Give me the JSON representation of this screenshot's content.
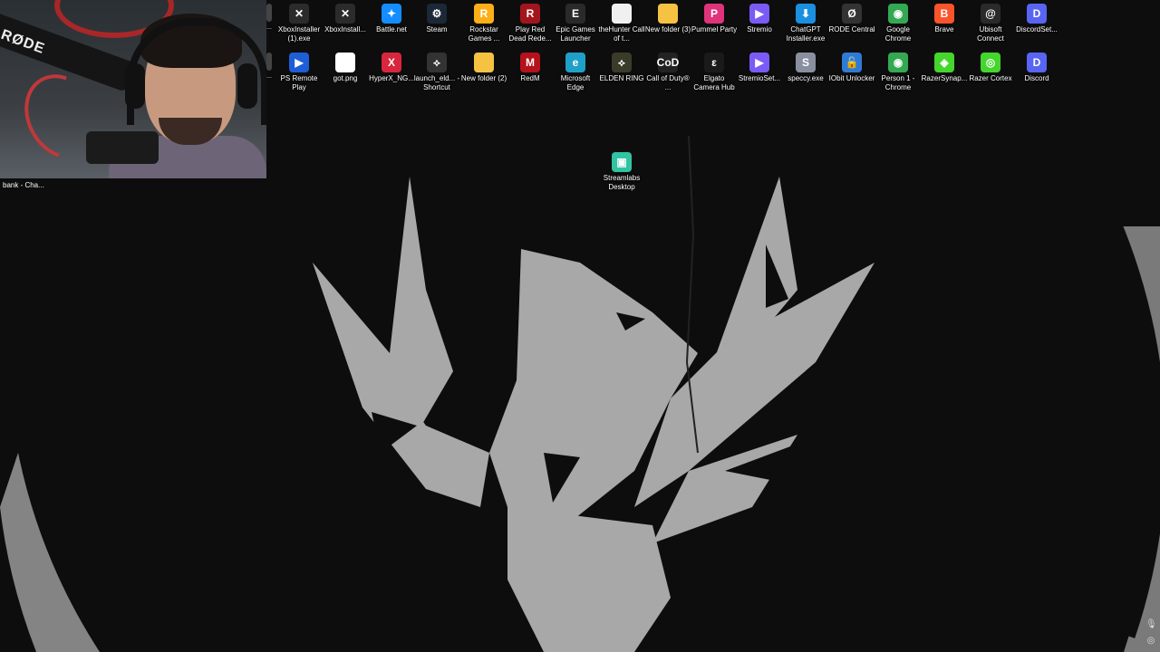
{
  "webcam": {
    "caption": "bank - Cha...",
    "mic_brand": "RØDE"
  },
  "desktop_icons": [
    {
      "label": "...",
      "icon": "generic-file-icon",
      "color": "#444444",
      "glyph": ""
    },
    {
      "label": "XboxInstaller (1).exe",
      "icon": "xbox-icon",
      "color": "#2b2b2b",
      "glyph": "✕"
    },
    {
      "label": "XboxInstall...",
      "icon": "xbox-icon",
      "color": "#2b2b2b",
      "glyph": "✕"
    },
    {
      "label": "Battle.net",
      "icon": "battlenet-icon",
      "color": "#148eff",
      "glyph": "✦"
    },
    {
      "label": "Steam",
      "icon": "steam-icon",
      "color": "#1b2838",
      "glyph": "⚙"
    },
    {
      "label": "Rockstar Games ...",
      "icon": "rockstar-icon",
      "color": "#fcaf17",
      "glyph": "R"
    },
    {
      "label": "Play Red Dead Rede...",
      "icon": "rdr2-icon",
      "color": "#a3151c",
      "glyph": "R"
    },
    {
      "label": "Epic Games Launcher",
      "icon": "epic-icon",
      "color": "#2a2a2a",
      "glyph": "E"
    },
    {
      "label": "theHunter Call of t...",
      "icon": "file-icon",
      "color": "#f0f0f0",
      "glyph": ""
    },
    {
      "label": "New folder (3)",
      "icon": "folder-icon",
      "color": "#f5c242",
      "glyph": ""
    },
    {
      "label": "Pummel Party",
      "icon": "pummel-party-icon",
      "color": "#e0337b",
      "glyph": "P"
    },
    {
      "label": "Stremio",
      "icon": "stremio-icon",
      "color": "#7b5bf5",
      "glyph": "▶"
    },
    {
      "label": "ChatGPT Installer.exe",
      "icon": "download-icon",
      "color": "#1b8fe0",
      "glyph": "⬇"
    },
    {
      "label": "RODE Central",
      "icon": "rode-icon",
      "color": "#333333",
      "glyph": "Ø"
    },
    {
      "label": "Google Chrome",
      "icon": "chrome-icon",
      "color": "#34a853",
      "glyph": "◉"
    },
    {
      "label": "Brave",
      "icon": "brave-icon",
      "color": "#fb542b",
      "glyph": "B"
    },
    {
      "label": "Ubisoft Connect",
      "icon": "ubisoft-icon",
      "color": "#2a2a2a",
      "glyph": "@"
    },
    {
      "label": "DiscordSet...",
      "icon": "discord-icon",
      "color": "#5865f2",
      "glyph": "D"
    },
    {
      "label": "...",
      "icon": "generic-file-icon",
      "color": "#444444",
      "glyph": ""
    },
    {
      "label": "PS Remote Play",
      "icon": "ps-remote-play-icon",
      "color": "#1e5ed6",
      "glyph": "▶"
    },
    {
      "label": "got.png",
      "icon": "image-file-icon",
      "color": "#ffffff",
      "glyph": ""
    },
    {
      "label": "HyperX_NG...",
      "icon": "hyperx-icon",
      "color": "#d7263d",
      "glyph": "X"
    },
    {
      "label": "launch_eld... - Shortcut",
      "icon": "elden-ring-shortcut-icon",
      "color": "#333333",
      "glyph": "⟡"
    },
    {
      "label": "New folder (2)",
      "icon": "folder-icon",
      "color": "#f5c242",
      "glyph": ""
    },
    {
      "label": "RedM",
      "icon": "redm-icon",
      "color": "#b5121b",
      "glyph": "M"
    },
    {
      "label": "Microsoft Edge",
      "icon": "edge-icon",
      "color": "#1fa0c8",
      "glyph": "e"
    },
    {
      "label": "ELDEN RING",
      "icon": "elden-ring-icon",
      "color": "#3b3b2a",
      "glyph": "⟡"
    },
    {
      "label": "Call of Duty® ...",
      "icon": "call-of-duty-icon",
      "color": "#222222",
      "glyph": "CoD"
    },
    {
      "label": "Elgato Camera Hub",
      "icon": "elgato-icon",
      "color": "#1a1a1a",
      "glyph": "ε"
    },
    {
      "label": "StremioSet...",
      "icon": "stremio-icon",
      "color": "#7b5bf5",
      "glyph": "▶"
    },
    {
      "label": "speccy.exe",
      "icon": "speccy-icon",
      "color": "#8a8fa0",
      "glyph": "S"
    },
    {
      "label": "IObit Unlocker",
      "icon": "unlock-icon",
      "color": "#2e7bd6",
      "glyph": "🔓"
    },
    {
      "label": "Person 1 - Chrome",
      "icon": "chrome-icon",
      "color": "#34a853",
      "glyph": "◉"
    },
    {
      "label": "RazerSynap...",
      "icon": "razer-icon",
      "color": "#44d62c",
      "glyph": "◈"
    },
    {
      "label": "Razer Cortex",
      "icon": "razer-cortex-icon",
      "color": "#44d62c",
      "glyph": "◎"
    },
    {
      "label": "Discord",
      "icon": "discord-icon",
      "color": "#5865f2",
      "glyph": "D"
    },
    {
      "label": "Streamlabs Desktop",
      "icon": "streamlabs-icon",
      "color": "#31c3a2",
      "glyph": "▣"
    }
  ],
  "tray": [
    {
      "icon": "microphone-icon",
      "glyph": "🎙"
    },
    {
      "icon": "location-icon",
      "glyph": "◎"
    }
  ]
}
